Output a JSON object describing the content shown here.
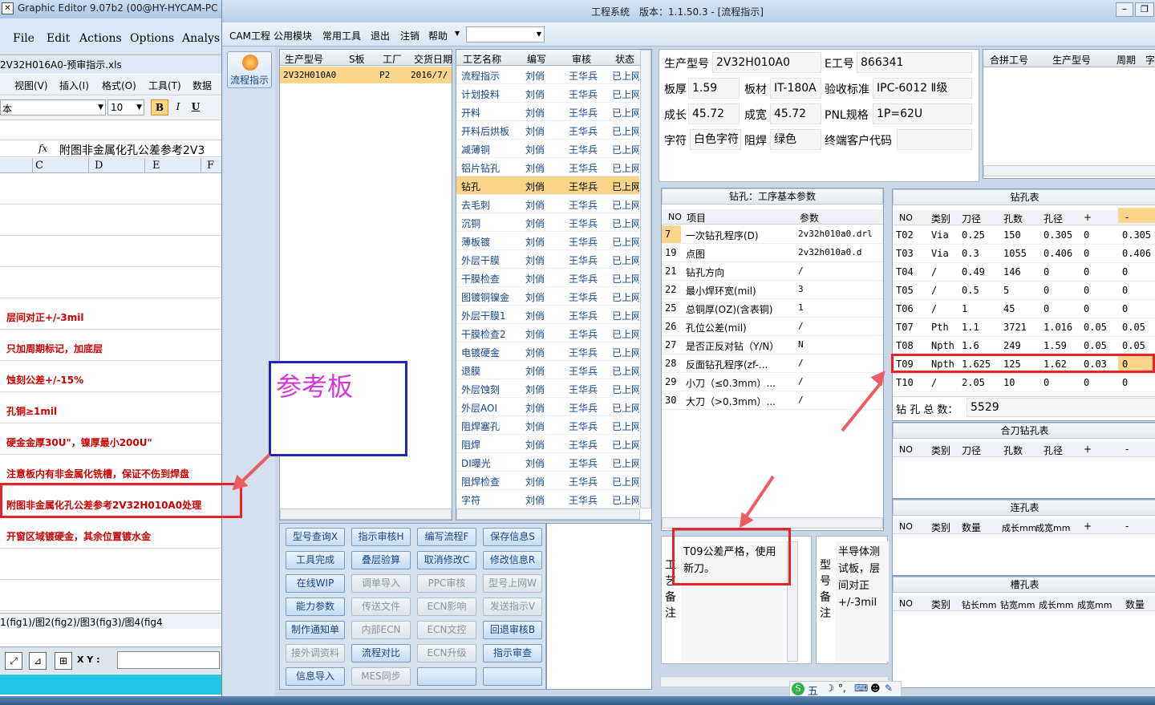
{
  "excel": {
    "title": "Graphic Editor 9.07b2 (00@HY-HYCAM-PC",
    "menu": [
      "File",
      "Edit",
      "Actions",
      "Options",
      "Analys"
    ],
    "filename": "2V32H016A0-预审指示.xls",
    "menu2": [
      "视图(V)",
      "插入(I)",
      "格式(O)",
      "工具(T)",
      "数据"
    ],
    "font_name": "本",
    "font_size": "10",
    "fmt_bold": "B",
    "fmt_italic": "I",
    "fmt_underline": "U",
    "fx": "fx",
    "formula": "附图非金属化孔公差参考2V3",
    "columns": [
      "C",
      "D",
      "E",
      "F"
    ],
    "rows": [
      "",
      "",
      "",
      "",
      "层间对正+/-3mil",
      "只加周期标记，加底层",
      "蚀刻公差+/-15%",
      "孔铜≥1mil",
      "硬金金厚30U\"，镍厚最小200U\"",
      "注意板内有非金属化铣槽，保证不伤到焊盘",
      "附图非金属化孔公差参考2V32H010A0处理",
      "开窗区域镀硬金，其余位置镀水金",
      "",
      ""
    ],
    "sheet_tabs": "1(fig1)/图2(fig2)/图3(fig3)/图4(fig4",
    "coord_label": "X Y :"
  },
  "annot": {
    "ref_board": "参考板",
    "bubble": "T09公差严格，使用新刀。"
  },
  "main": {
    "title": "工程系统　版本：1.1.50.3 - [流程指示]",
    "menu": [
      "CAM工程",
      "公用模块",
      "常用工具",
      "退出",
      "注销",
      "帮助"
    ],
    "side_button": "流程指示",
    "orders_head": [
      "生产型号",
      "S板",
      "工厂",
      "交货日期"
    ],
    "orders": [
      {
        "model": "2V32H010A0",
        "s": "",
        "factory": "P2",
        "date": "2016/7/"
      }
    ],
    "proc_head": [
      "工艺名称",
      "编写",
      "审核",
      "状态"
    ],
    "procs": [
      "流程指示",
      "计划投料",
      "开料",
      "开料后烘板",
      "减薄铜",
      "铝片钻孔",
      "钻孔",
      "去毛刺",
      "沉铜",
      "薄板镀",
      "外层干膜",
      "干膜检查",
      "图镀铜镍金",
      "外层干膜1",
      "干膜检查2",
      "电镀硬金",
      "退膜",
      "外层蚀刻",
      "外层AOI",
      "阻焊塞孔",
      "阻焊",
      "DI曝光",
      "阻焊检查",
      "字符"
    ],
    "proc_writer": "刘俏",
    "proc_checker": "王华兵",
    "proc_status": "已上网",
    "buttons": [
      [
        "型号查询X",
        "指示审核H",
        "编写流程F",
        "保存信息S"
      ],
      [
        "工具完成",
        "叠层验算",
        "取消修改C",
        "修改信息R"
      ],
      [
        "在线WIP",
        "调单导入",
        "PPC审核",
        "型号上网W"
      ],
      [
        "能力参数",
        "传送文件",
        "ECN影响",
        "发送指示V"
      ],
      [
        "制作通知单",
        "内部ECN",
        "ECN文控",
        "回退审核B"
      ],
      [
        "接外调资料",
        "流程对比",
        "ECN升级",
        "指示审查"
      ],
      [
        "信息导入",
        "MES同步",
        "",
        ""
      ]
    ],
    "info": {
      "model_label": "生产型号",
      "model": "2V32H010A0",
      "e_label": "E工号",
      "e_no": "866341",
      "thick_label": "板厚",
      "thick": "1.59",
      "mat_label": "板材",
      "mat": "IT-180A",
      "std_label": "验收标准",
      "std": "IPC-6012 Ⅱ级",
      "len_label": "成长",
      "len": "45.72",
      "wid_label": "成宽",
      "wid": "45.72",
      "pnl_label": "PNL规格",
      "pnl": "1P=62U",
      "char_label": "字符",
      "char": "白色字符",
      "mask_label": "阻焊",
      "mask": "绿色",
      "cust_label": "终端客户代码",
      "cust": ""
    },
    "combine_head": [
      "合拼工号",
      "生产型号",
      "周期",
      "字"
    ],
    "drill_params": {
      "title": "钻孔：工序基本参数",
      "head": [
        "NO",
        "项目",
        "参数"
      ],
      "rows": [
        [
          "7",
          "一次钻孔程序(D)",
          "2v32h010a0.drl"
        ],
        [
          "19",
          "点图",
          "2v32h010a0.d"
        ],
        [
          "21",
          "钻孔方向",
          "/"
        ],
        [
          "22",
          "最小焊环宽(mil)",
          "3"
        ],
        [
          "25",
          "总铜厚(OZ)(含表铜)",
          "1"
        ],
        [
          "26",
          "孔位公差(mil)",
          "/"
        ],
        [
          "27",
          "是否正反对钻（Y/N）",
          "N"
        ],
        [
          "28",
          "反面钻孔程序(zf-...",
          "/"
        ],
        [
          "29",
          "小刀（≤0.3mm）...",
          "/"
        ],
        [
          "30",
          "大刀（>0.3mm）...",
          "/"
        ]
      ]
    },
    "drill_table": {
      "title": "钻孔表",
      "head": [
        "NO",
        "类别",
        "刀径",
        "孔数",
        "孔径",
        "+",
        "-"
      ],
      "rows": [
        [
          "T02",
          "Via",
          "0.25",
          "150",
          "0.305",
          "0",
          "0.305"
        ],
        [
          "T03",
          "Via",
          "0.3",
          "1055",
          "0.406",
          "0",
          "0.406"
        ],
        [
          "T04",
          "/",
          "0.49",
          "146",
          "0",
          "0",
          "0"
        ],
        [
          "T05",
          "/",
          "0.5",
          "5",
          "0",
          "0",
          "0"
        ],
        [
          "T06",
          "/",
          "1",
          "45",
          "0",
          "0",
          "0"
        ],
        [
          "T07",
          "Pth",
          "1.1",
          "3721",
          "1.016",
          "0.05",
          "0.05"
        ],
        [
          "T08",
          "Npth",
          "1.6",
          "249",
          "1.59",
          "0.05",
          "0.05"
        ],
        [
          "T09",
          "Npth",
          "1.625",
          "125",
          "1.62",
          "0.03",
          "0"
        ],
        [
          "T10",
          "/",
          "2.05",
          "10",
          "0",
          "0",
          "0"
        ]
      ],
      "total_label": "钻 孔 总 数：",
      "total": "5529"
    },
    "combo_table": {
      "title": "合刀钻孔表",
      "head": [
        "NO",
        "类别",
        "刀径",
        "孔数",
        "孔径",
        "+",
        "-"
      ]
    },
    "link_table": {
      "title": "连孔表",
      "head": [
        "NO",
        "类别",
        "数量",
        "成长mm",
        "成宽mm",
        "+",
        "-"
      ]
    },
    "slot_table": {
      "title": "槽孔表",
      "head": [
        "NO",
        "类别",
        "钻长mm",
        "钻宽mm",
        "成长mm",
        "成宽mm",
        "数量"
      ]
    },
    "craft_label": "工艺备注",
    "craft_note": "T09公差严格，使用新刀。",
    "model_note_label": "型号备注",
    "model_note": "半导体测试板，层间对正+/-3mil"
  },
  "tray": {
    "ime": "五"
  },
  "colors": {
    "red": "#e8242b",
    "excel_red": "#cc0000",
    "hilite": "#fbd58a",
    "title_blue": "#15458c"
  }
}
